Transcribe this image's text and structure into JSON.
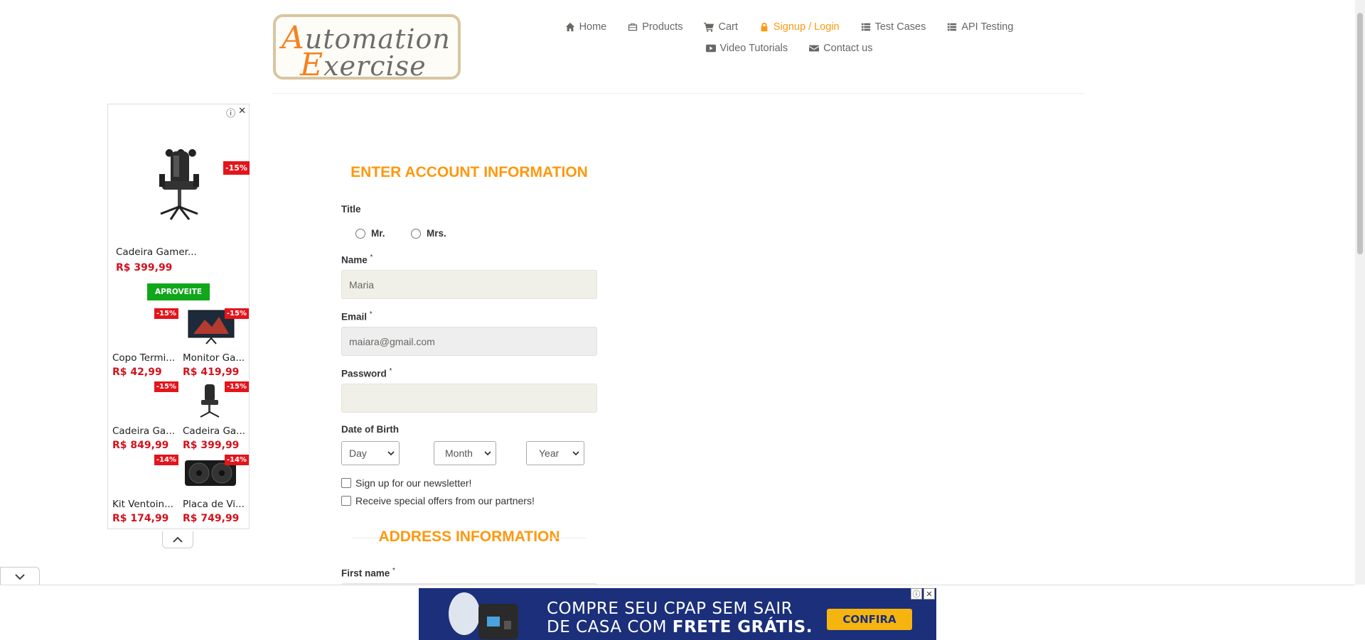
{
  "header": {
    "logo_line1": "utomation",
    "logo_line2": "xercise",
    "logo_initial1": "A",
    "logo_initial2": "E"
  },
  "nav": {
    "row1": [
      {
        "label": "Home",
        "icon": "home-icon"
      },
      {
        "label": "Products",
        "icon": "products-icon"
      },
      {
        "label": "Cart",
        "icon": "cart-icon"
      },
      {
        "label": "Signup / Login",
        "icon": "lock-icon",
        "active": true
      },
      {
        "label": "Test Cases",
        "icon": "list-icon"
      },
      {
        "label": "API Testing",
        "icon": "list-icon"
      }
    ],
    "row2": [
      {
        "label": "Video Tutorials",
        "icon": "video-icon"
      },
      {
        "label": "Contact us",
        "icon": "envelope-icon"
      }
    ],
    "active_color": "#fe980f"
  },
  "left_ad": {
    "info_icon": "ⓘ",
    "close_icon": "✕",
    "featured": {
      "name": "Cadeira Gamer...",
      "price": "R$ 399,99",
      "discount": "-15%",
      "cta": "APROVEITE"
    },
    "items": [
      {
        "name": "Copo Termi...",
        "price": "R$ 42,99",
        "discount": "-15%"
      },
      {
        "name": "Monitor Ga...",
        "price": "R$ 419,99",
        "discount": "-15%"
      },
      {
        "name": "Cadeira Ga...",
        "price": "R$ 849,99",
        "discount": "-15%"
      },
      {
        "name": "Cadeira Ga...",
        "price": "R$ 399,99",
        "discount": "-15%"
      },
      {
        "name": "Kit Ventoin...",
        "price": "R$ 174,99",
        "discount": "-14%"
      },
      {
        "name": "Placa de Vi...",
        "price": "R$ 749,99",
        "discount": "-14%"
      }
    ]
  },
  "form": {
    "section_account": "ENTER ACCOUNT INFORMATION",
    "title_label": "Title",
    "title_options": [
      "Mr.",
      "Mrs."
    ],
    "name_label": "Name",
    "name_value": "Maria",
    "email_label": "Email",
    "email_value": "maiara@gmail.com",
    "password_label": "Password",
    "password_value": "",
    "dob_label": "Date of Birth",
    "dob_day": "Day",
    "dob_month": "Month",
    "dob_year": "Year",
    "newsletter_label": "Sign up for our newsletter!",
    "offers_label": "Receive special offers from our partners!",
    "section_address": "ADDRESS INFORMATION",
    "first_name_label": "First name",
    "required_mark": "*"
  },
  "bottom_ad": {
    "line1": "COMPRE SEU CPAP SEM SAIR",
    "line2_prefix": "DE CASA COM ",
    "line2_bold": "FRETE GRÁTIS.",
    "button": "CONFIRA",
    "info_icon": "ⓘ",
    "close_icon": "✕"
  }
}
